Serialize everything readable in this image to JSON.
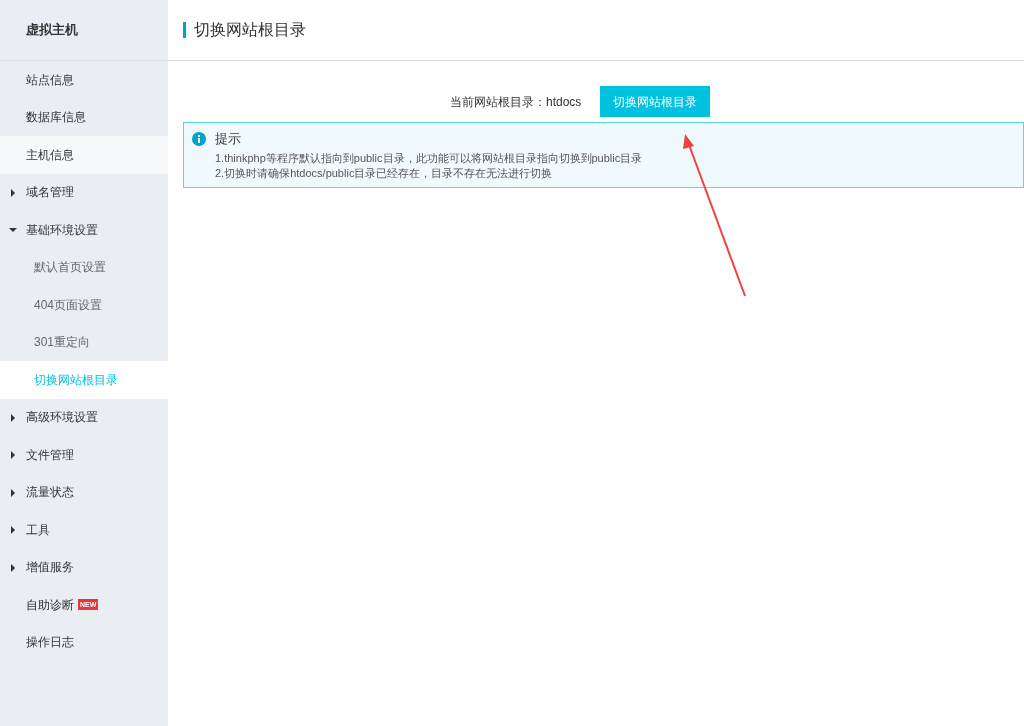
{
  "sidebar": {
    "title": "虚拟主机",
    "items": [
      {
        "label": "站点信息",
        "selected": false,
        "hovered": false
      },
      {
        "label": "数据库信息",
        "selected": false,
        "hovered": false
      },
      {
        "label": "主机信息",
        "selected": false,
        "hovered": true
      },
      {
        "label": "域名管理",
        "selected": false,
        "hovered": false,
        "expanded": false
      },
      {
        "label": "基础环境设置",
        "selected": false,
        "hovered": false,
        "expanded": true,
        "children": [
          {
            "label": "默认首页设置",
            "selected": false,
            "hovered": false
          },
          {
            "label": "404页面设置",
            "selected": false,
            "hovered": false
          },
          {
            "label": "301重定向",
            "selected": false,
            "hovered": false
          },
          {
            "label": "切换网站根目录",
            "selected": true,
            "hovered": false
          }
        ]
      },
      {
        "label": "高级环境设置",
        "selected": false,
        "hovered": false,
        "expanded": false
      },
      {
        "label": "文件管理",
        "selected": false,
        "hovered": false,
        "expanded": false
      },
      {
        "label": "流量状态",
        "selected": false,
        "hovered": false,
        "expanded": false
      },
      {
        "label": "工具",
        "selected": false,
        "hovered": false,
        "expanded": false
      },
      {
        "label": "增值服务",
        "selected": false,
        "hovered": false,
        "expanded": false
      },
      {
        "label": "自助诊断",
        "selected": false,
        "hovered": false,
        "badge": "NEW"
      },
      {
        "label": "操作日志",
        "selected": false,
        "hovered": false
      }
    ]
  },
  "page": {
    "title": "切换网站根目录",
    "current_root_label": "当前网站根目录：htdocs",
    "switch_button": "切换网站根目录",
    "notice": {
      "title": "提示",
      "lines": [
        "1.thinkphp等程序默认指向到public目录，此功能可以将网站根目录指向切换到public目录",
        "2.切换时请确保htdocs/public目录已经存在，目录不存在无法进行切换"
      ]
    }
  }
}
